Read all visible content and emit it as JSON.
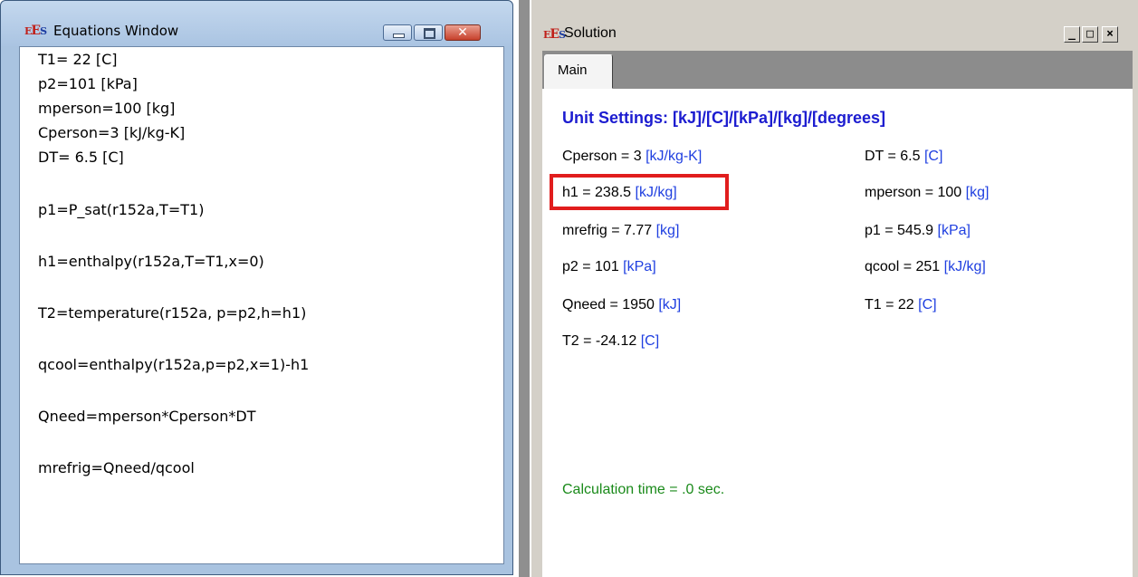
{
  "equations_window": {
    "title": "Equations Window",
    "lines": [
      "T1= 22 [C]",
      "p2=101 [kPa]",
      "mperson=100 [kg]",
      "Cperson=3 [kJ/kg-K]",
      "DT= 6.5 [C]",
      "p1=P_sat(r152a,T=T1)",
      "h1=enthalpy(r152a,T=T1,x=0)",
      "T2=temperature(r152a, p=p2,h=h1)",
      "qcool=enthalpy(r152a,p=p2,x=1)-h1",
      "Qneed=mperson*Cperson*DT",
      "mrefrig=Qneed/qcool"
    ]
  },
  "solution_window": {
    "title": "Solution",
    "tab_main": "Main",
    "unit_settings": "Unit Settings: [kJ]/[C]/[kPa]/[kg]/[degrees]",
    "variables": [
      {
        "text": "Cperson  = 3 ",
        "unit": "[kJ/kg-K]"
      },
      {
        "text": "DT = 6.5 ",
        "unit": "[C]"
      },
      {
        "text": "h1 = 238.5 ",
        "unit": "[kJ/kg]"
      },
      {
        "text": "mperson = 100  ",
        "unit": "[kg]"
      },
      {
        "text": "mrefrig = 7.77 ",
        "unit": "[kg]"
      },
      {
        "text": "p1 = 545.9 ",
        "unit": "[kPa]"
      },
      {
        "text": "p2 = 101  ",
        "unit": "[kPa]"
      },
      {
        "text": "qcool = 251  ",
        "unit": "[kJ/kg]"
      },
      {
        "text": "Qneed = 1950  ",
        "unit": "[kJ]"
      },
      {
        "text": "T1  = 22  ",
        "unit": "[C]"
      },
      {
        "text": "T2  = -24.12  ",
        "unit": "[C]"
      }
    ],
    "calc_time": "Calculation time = .0 sec.",
    "window_controls": {
      "minimize": "_",
      "maximize": "□",
      "close": "×"
    }
  },
  "app_logo": {
    "e1": "E",
    "e2": "E",
    "s": "S"
  },
  "colors": {
    "unit_blue": "#1f3fe0",
    "heading_blue": "#1c1cd0",
    "calc_green": "#1a8a1a",
    "highlight_red": "#e11d1d"
  }
}
